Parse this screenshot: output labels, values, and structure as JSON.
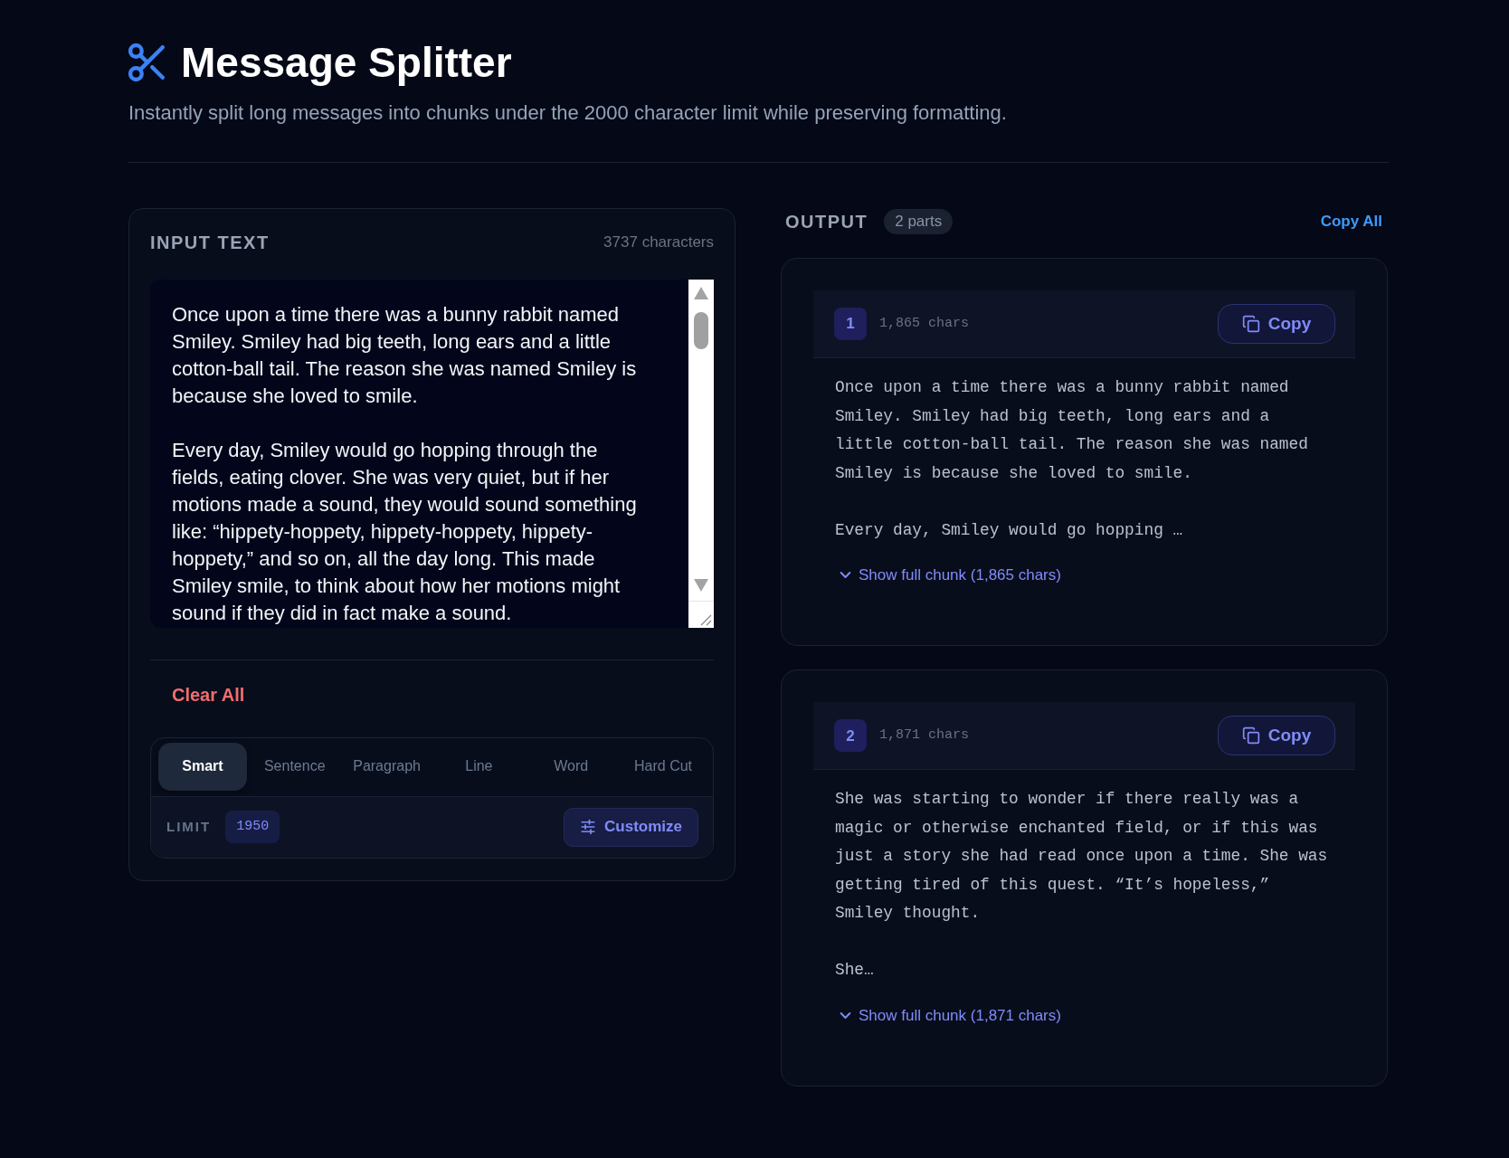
{
  "header": {
    "title": "Message Splitter",
    "subtitle": "Instantly split long messages into chunks under the 2000 character limit while preserving formatting."
  },
  "input_panel": {
    "title": "INPUT TEXT",
    "char_count": "3737 characters",
    "text": "Once upon a time there was a bunny rabbit named Smiley. Smiley had big teeth, long ears and a little cotton-ball tail. The reason she was named Smiley is because she loved to smile.\n\nEvery day, Smiley would go hopping through the fields, eating clover. She was very quiet, but if her motions made a sound, they would sound something like: “hippety-hoppety, hippety-hoppety, hippety-hoppety,” and so on, all the day long. This made Smiley smile, to think about how her motions might sound if they did in fact make a sound.",
    "clear_button": "Clear All",
    "modes": [
      {
        "label": "Smart",
        "selected": true
      },
      {
        "label": "Sentence",
        "selected": false
      },
      {
        "label": "Paragraph",
        "selected": false
      },
      {
        "label": "Line",
        "selected": false
      },
      {
        "label": "Word",
        "selected": false
      },
      {
        "label": "Hard Cut",
        "selected": false
      }
    ],
    "limit": {
      "label": "LIMIT",
      "value": "1950"
    },
    "customize_button": "Customize"
  },
  "output_panel": {
    "title": "OUTPUT",
    "count": "2 parts",
    "copy_all": "Copy All",
    "chunks": [
      {
        "number": "1",
        "chars": "1,865 chars",
        "copy_button": "Copy",
        "preview": [
          "Once upon a time there was a bunny rabbit named Smiley. Smiley had big teeth, long ears and a little cotton-ball tail. The reason she was named Smiley is because she loved to smile.",
          "Every day, Smiley would go hopping …"
        ],
        "expand_link": "Show full chunk (1,865 chars)"
      },
      {
        "number": "2",
        "chars": "1,871 chars",
        "copy_button": "Copy",
        "preview": [
          "She was starting to wonder if there really was a magic or otherwise enchanted field, or if this was just a story she had read once upon a time. She was getting tired of this quest. “It’s hopeless,” Smiley thought.",
          "She…"
        ],
        "expand_link": "Show full chunk (1,871 chars)"
      }
    ]
  }
}
